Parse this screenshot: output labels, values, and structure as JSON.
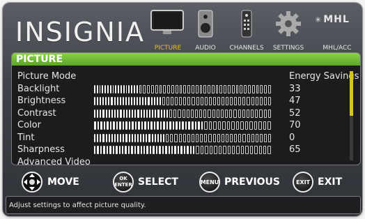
{
  "brand": "INSIGNIA",
  "nav": [
    {
      "label": "PICTURE",
      "active": true,
      "icon": "tv-icon"
    },
    {
      "label": "AUDIO",
      "active": false,
      "icon": "speaker-icon"
    },
    {
      "label": "CHANNELS",
      "active": false,
      "icon": "remote-icon"
    },
    {
      "label": "SETTINGS",
      "active": false,
      "icon": "gear-icon"
    },
    {
      "label": "MHL/ACC",
      "active": false,
      "icon": "mhl-logo-icon",
      "logo_text": "MHL"
    }
  ],
  "panel": {
    "title": "PICTURE",
    "rows": [
      {
        "label": "Picture Mode",
        "value": "Energy Savings"
      },
      {
        "label": "Backlight",
        "value": "33",
        "level": 33
      },
      {
        "label": "Brightness",
        "value": "47",
        "level": 47
      },
      {
        "label": "Contrast",
        "value": "52",
        "level": 52
      },
      {
        "label": "Color",
        "value": "70",
        "level": 70
      },
      {
        "label": "Tint",
        "value": "0",
        "level": 50
      },
      {
        "label": "Sharpness",
        "value": "65",
        "level": 65
      },
      {
        "label": "Advanced Video",
        "value": ""
      }
    ],
    "scroll_fraction": 0.5
  },
  "controls": [
    {
      "button": "",
      "label": "MOVE",
      "icon": "dpad-icon"
    },
    {
      "button": "OK ENTER",
      "label": "SELECT"
    },
    {
      "button": "MENU",
      "label": "PREVIOUS"
    },
    {
      "button": "EXIT",
      "label": "EXIT"
    }
  ],
  "help_text": "Adjust settings to affect picture quality.",
  "colors": {
    "accent_green": "#6bb833",
    "active_label": "#e8c020",
    "scroll_thumb": "#d4c428"
  }
}
